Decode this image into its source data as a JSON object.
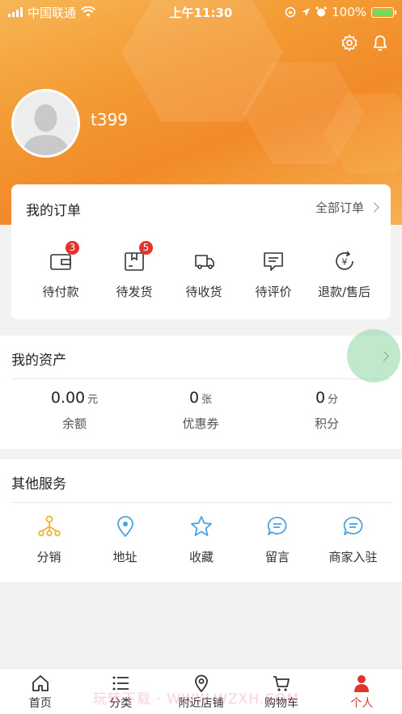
{
  "status_bar": {
    "carrier": "中国联通",
    "time": "上午11:30",
    "battery": "100%",
    "battery_level": 1.0
  },
  "profile": {
    "username": "t399"
  },
  "orders": {
    "title": "我的订单",
    "all_label": "全部订单",
    "items": [
      {
        "label": "待付款",
        "icon": "wallet-icon",
        "badge": "3"
      },
      {
        "label": "待发货",
        "icon": "package-icon",
        "badge": "5"
      },
      {
        "label": "待收货",
        "icon": "truck-icon",
        "badge": ""
      },
      {
        "label": "待评价",
        "icon": "comment-icon",
        "badge": ""
      },
      {
        "label": "退款/售后",
        "icon": "refund-icon",
        "badge": ""
      }
    ]
  },
  "assets": {
    "title": "我的资产",
    "items": [
      {
        "value": "0.00",
        "unit": "元",
        "label": "余额"
      },
      {
        "value": "0",
        "unit": "张",
        "label": "优惠券"
      },
      {
        "value": "0",
        "unit": "分",
        "label": "积分"
      }
    ]
  },
  "services": {
    "title": "其他服务",
    "items": [
      {
        "label": "分销",
        "icon": "distribution-icon"
      },
      {
        "label": "地址",
        "icon": "location-pin-icon"
      },
      {
        "label": "收藏",
        "icon": "star-icon"
      },
      {
        "label": "留言",
        "icon": "message-icon"
      },
      {
        "label": "商家入驻",
        "icon": "merchant-message-icon"
      }
    ]
  },
  "tabbar": {
    "items": [
      {
        "label": "首页",
        "icon": "home-icon"
      },
      {
        "label": "分类",
        "icon": "list-icon"
      },
      {
        "label": "附近店铺",
        "icon": "map-pin-icon"
      },
      {
        "label": "购物车",
        "icon": "cart-icon"
      },
      {
        "label": "个人",
        "icon": "person-icon",
        "active": true
      }
    ]
  },
  "watermark": "玩转下载 · WWW.WZXH.COM",
  "colors": {
    "accent": "#f39a33",
    "badge": "#e0342c",
    "service_blue": "#4aa3df",
    "service_gold": "#f0b429"
  }
}
